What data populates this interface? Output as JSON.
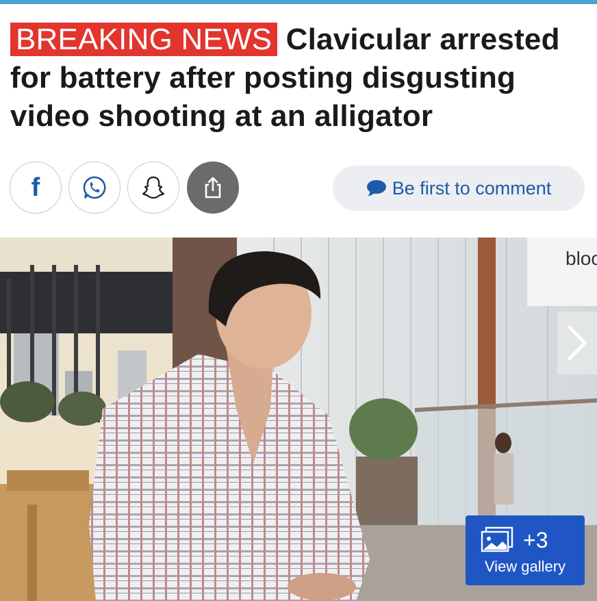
{
  "article": {
    "badge": "BREAKING NEWS",
    "title": "Clavicular arrested for battery after posting disgusting video shooting at an alligator"
  },
  "share": {
    "icons": [
      "facebook-icon",
      "whatsapp-icon",
      "snapchat-icon",
      "share-icon"
    ],
    "facebook_glyph": "f",
    "comment_label": "Be first to comment"
  },
  "photo": {
    "store_sign": "bloo",
    "gallery_count": "+3",
    "gallery_label": "View gallery"
  },
  "colors": {
    "accent_bar": "#4aa3cf",
    "badge_bg": "#e1352d",
    "link_blue": "#1e5aa8",
    "gallery_bg": "#1f56c4"
  }
}
